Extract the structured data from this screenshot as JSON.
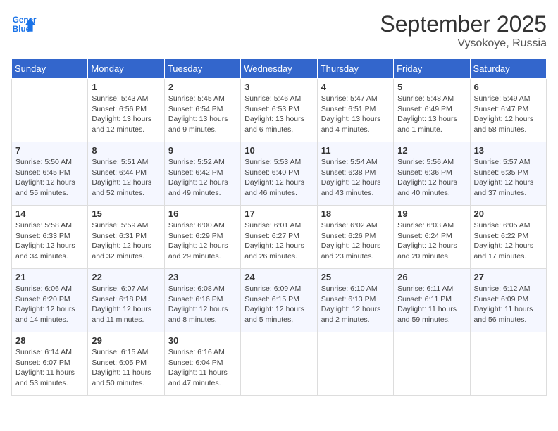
{
  "logo": {
    "line1": "General",
    "line2": "Blue"
  },
  "title": "September 2025",
  "location": "Vysokoye, Russia",
  "days_of_week": [
    "Sunday",
    "Monday",
    "Tuesday",
    "Wednesday",
    "Thursday",
    "Friday",
    "Saturday"
  ],
  "weeks": [
    [
      {
        "day": "",
        "info": ""
      },
      {
        "day": "1",
        "info": "Sunrise: 5:43 AM\nSunset: 6:56 PM\nDaylight: 13 hours\nand 12 minutes."
      },
      {
        "day": "2",
        "info": "Sunrise: 5:45 AM\nSunset: 6:54 PM\nDaylight: 13 hours\nand 9 minutes."
      },
      {
        "day": "3",
        "info": "Sunrise: 5:46 AM\nSunset: 6:53 PM\nDaylight: 13 hours\nand 6 minutes."
      },
      {
        "day": "4",
        "info": "Sunrise: 5:47 AM\nSunset: 6:51 PM\nDaylight: 13 hours\nand 4 minutes."
      },
      {
        "day": "5",
        "info": "Sunrise: 5:48 AM\nSunset: 6:49 PM\nDaylight: 13 hours\nand 1 minute."
      },
      {
        "day": "6",
        "info": "Sunrise: 5:49 AM\nSunset: 6:47 PM\nDaylight: 12 hours\nand 58 minutes."
      }
    ],
    [
      {
        "day": "7",
        "info": "Sunrise: 5:50 AM\nSunset: 6:45 PM\nDaylight: 12 hours\nand 55 minutes."
      },
      {
        "day": "8",
        "info": "Sunrise: 5:51 AM\nSunset: 6:44 PM\nDaylight: 12 hours\nand 52 minutes."
      },
      {
        "day": "9",
        "info": "Sunrise: 5:52 AM\nSunset: 6:42 PM\nDaylight: 12 hours\nand 49 minutes."
      },
      {
        "day": "10",
        "info": "Sunrise: 5:53 AM\nSunset: 6:40 PM\nDaylight: 12 hours\nand 46 minutes."
      },
      {
        "day": "11",
        "info": "Sunrise: 5:54 AM\nSunset: 6:38 PM\nDaylight: 12 hours\nand 43 minutes."
      },
      {
        "day": "12",
        "info": "Sunrise: 5:56 AM\nSunset: 6:36 PM\nDaylight: 12 hours\nand 40 minutes."
      },
      {
        "day": "13",
        "info": "Sunrise: 5:57 AM\nSunset: 6:35 PM\nDaylight: 12 hours\nand 37 minutes."
      }
    ],
    [
      {
        "day": "14",
        "info": "Sunrise: 5:58 AM\nSunset: 6:33 PM\nDaylight: 12 hours\nand 34 minutes."
      },
      {
        "day": "15",
        "info": "Sunrise: 5:59 AM\nSunset: 6:31 PM\nDaylight: 12 hours\nand 32 minutes."
      },
      {
        "day": "16",
        "info": "Sunrise: 6:00 AM\nSunset: 6:29 PM\nDaylight: 12 hours\nand 29 minutes."
      },
      {
        "day": "17",
        "info": "Sunrise: 6:01 AM\nSunset: 6:27 PM\nDaylight: 12 hours\nand 26 minutes."
      },
      {
        "day": "18",
        "info": "Sunrise: 6:02 AM\nSunset: 6:26 PM\nDaylight: 12 hours\nand 23 minutes."
      },
      {
        "day": "19",
        "info": "Sunrise: 6:03 AM\nSunset: 6:24 PM\nDaylight: 12 hours\nand 20 minutes."
      },
      {
        "day": "20",
        "info": "Sunrise: 6:05 AM\nSunset: 6:22 PM\nDaylight: 12 hours\nand 17 minutes."
      }
    ],
    [
      {
        "day": "21",
        "info": "Sunrise: 6:06 AM\nSunset: 6:20 PM\nDaylight: 12 hours\nand 14 minutes."
      },
      {
        "day": "22",
        "info": "Sunrise: 6:07 AM\nSunset: 6:18 PM\nDaylight: 12 hours\nand 11 minutes."
      },
      {
        "day": "23",
        "info": "Sunrise: 6:08 AM\nSunset: 6:16 PM\nDaylight: 12 hours\nand 8 minutes."
      },
      {
        "day": "24",
        "info": "Sunrise: 6:09 AM\nSunset: 6:15 PM\nDaylight: 12 hours\nand 5 minutes."
      },
      {
        "day": "25",
        "info": "Sunrise: 6:10 AM\nSunset: 6:13 PM\nDaylight: 12 hours\nand 2 minutes."
      },
      {
        "day": "26",
        "info": "Sunrise: 6:11 AM\nSunset: 6:11 PM\nDaylight: 11 hours\nand 59 minutes."
      },
      {
        "day": "27",
        "info": "Sunrise: 6:12 AM\nSunset: 6:09 PM\nDaylight: 11 hours\nand 56 minutes."
      }
    ],
    [
      {
        "day": "28",
        "info": "Sunrise: 6:14 AM\nSunset: 6:07 PM\nDaylight: 11 hours\nand 53 minutes."
      },
      {
        "day": "29",
        "info": "Sunrise: 6:15 AM\nSunset: 6:05 PM\nDaylight: 11 hours\nand 50 minutes."
      },
      {
        "day": "30",
        "info": "Sunrise: 6:16 AM\nSunset: 6:04 PM\nDaylight: 11 hours\nand 47 minutes."
      },
      {
        "day": "",
        "info": ""
      },
      {
        "day": "",
        "info": ""
      },
      {
        "day": "",
        "info": ""
      },
      {
        "day": "",
        "info": ""
      }
    ]
  ]
}
